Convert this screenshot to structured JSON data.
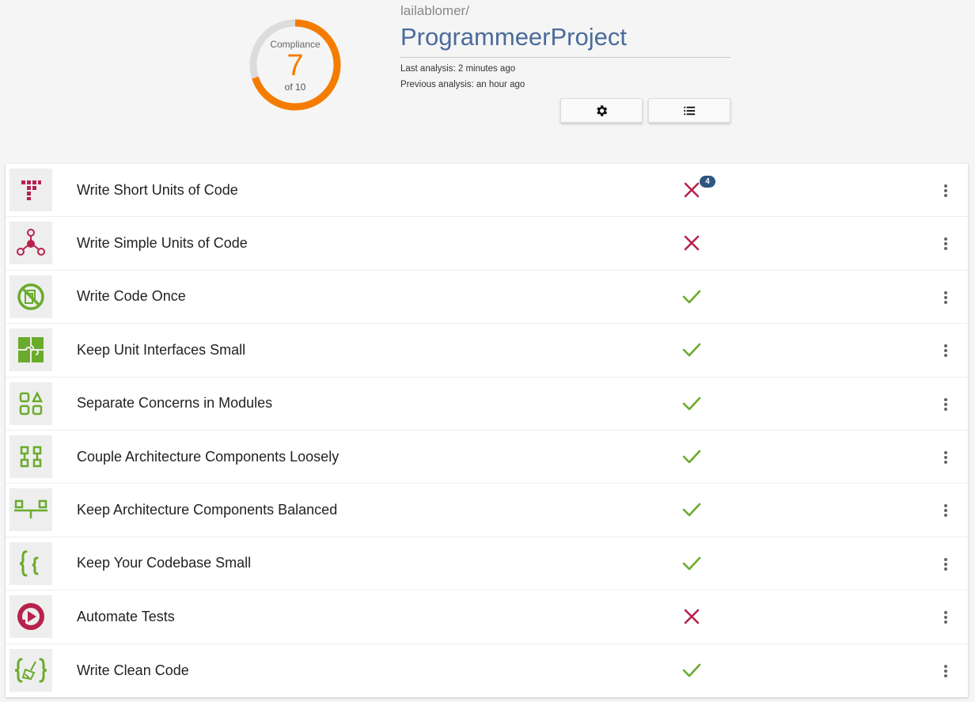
{
  "header": {
    "gauge": {
      "label": "Compliance",
      "value": "7",
      "of": "of 10",
      "fraction": 0.7,
      "color": "#f57c00",
      "track_color": "#dcdcdc"
    },
    "owner": "lailablomer/",
    "project": "ProgrammeerProject",
    "last_analysis": "Last analysis: 2 minutes ago",
    "previous_analysis": "Previous analysis: an hour ago",
    "buttons": [
      {
        "icon": "gear-icon"
      },
      {
        "icon": "list-icon"
      }
    ]
  },
  "colors": {
    "fail": "#b7224d",
    "pass": "#6aab2c",
    "badge": "#2f5580"
  },
  "guidelines": [
    {
      "label": "Write Short Units of Code",
      "icon": "short-units-icon",
      "status": "fail",
      "badge": "4"
    },
    {
      "label": "Write Simple Units of Code",
      "icon": "simple-units-icon",
      "status": "fail"
    },
    {
      "label": "Write Code Once",
      "icon": "no-duplication-icon",
      "status": "pass"
    },
    {
      "label": "Keep Unit Interfaces Small",
      "icon": "puzzle-icon",
      "status": "pass"
    },
    {
      "label": "Separate Concerns in Modules",
      "icon": "modules-icon",
      "status": "pass"
    },
    {
      "label": "Couple Architecture Components Loosely",
      "icon": "components-icon",
      "status": "pass"
    },
    {
      "label": "Keep Architecture Components Balanced",
      "icon": "balance-icon",
      "status": "pass"
    },
    {
      "label": "Keep Your Codebase Small",
      "icon": "braces-icon",
      "status": "pass"
    },
    {
      "label": "Automate Tests",
      "icon": "automate-tests-icon",
      "status": "fail"
    },
    {
      "label": "Write Clean Code",
      "icon": "clean-code-icon",
      "status": "pass"
    }
  ]
}
